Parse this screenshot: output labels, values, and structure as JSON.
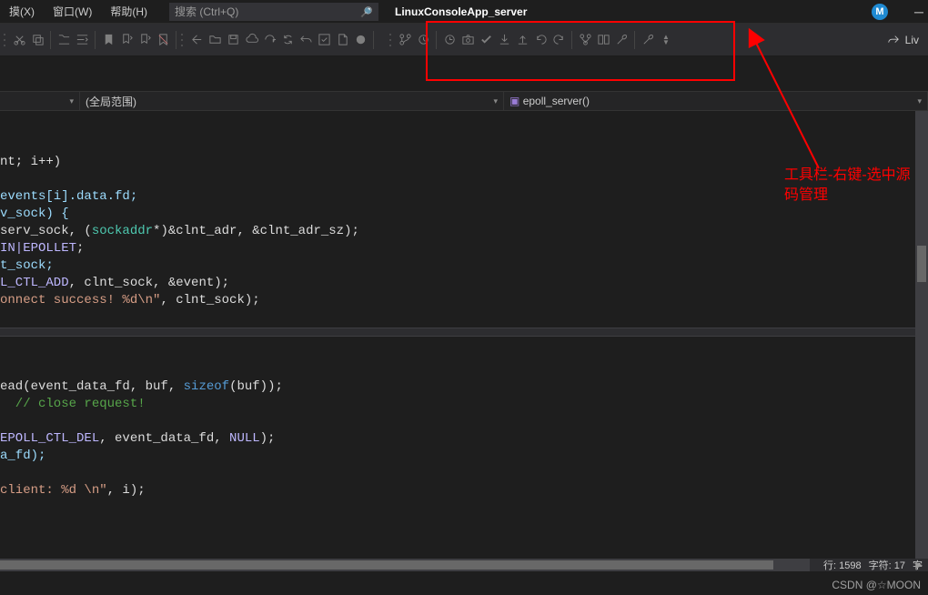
{
  "menus": {
    "m1": "摸(X)",
    "m2": "窗口(W)",
    "m3": "帮助(H)"
  },
  "search": {
    "placeholder": "搜索 (Ctrl+Q)"
  },
  "solution": {
    "title": "LinuxConsoleApp_server"
  },
  "avatar": {
    "initial": "M"
  },
  "liveshare": "Liv",
  "nav": {
    "scope": "(全局范围)",
    "function": "epoll_server()"
  },
  "code": {
    "l1": "nt; i++)",
    "l2": "",
    "l3a": "events[i].data.fd;",
    "l4a": "v_sock) {",
    "l5_pre": "serv_sock, (",
    "l5_t": "sockaddr",
    "l5_post": "*)&clnt_adr, &clnt_adr_sz);",
    "l6a": "IN|",
    "l6b": "EPOLLET",
    "l6c": ";",
    "l7a": "t_sock;",
    "l8a": "L_CTL_ADD",
    "l8b": ", clnt_sock, &event);",
    "l9a": "onnect success! %d\\n\"",
    "l9b": ", clnt_sock);",
    "gap1": "",
    "l10a": "ead(event_data_fd, buf, ",
    "l10b": "sizeof",
    "l10c": "(buf));",
    "l11a": "  // close request!",
    "l12": "",
    "l13a": "EPOLL_CTL_DEL",
    "l13b": ", event_data_fd, ",
    "l13c": "NULL",
    "l13d": ");",
    "l14a": "a_fd);",
    "l15": "",
    "l16a": "client: %d \\n\"",
    "l16b": ", i);"
  },
  "annotation": {
    "line1": "工具栏-右键-选中源",
    "line2": "码管理"
  },
  "status": {
    "line": "行: 1598",
    "chars": "字符: 17",
    "more": "字"
  },
  "watermark": "CSDN @☆MOON"
}
